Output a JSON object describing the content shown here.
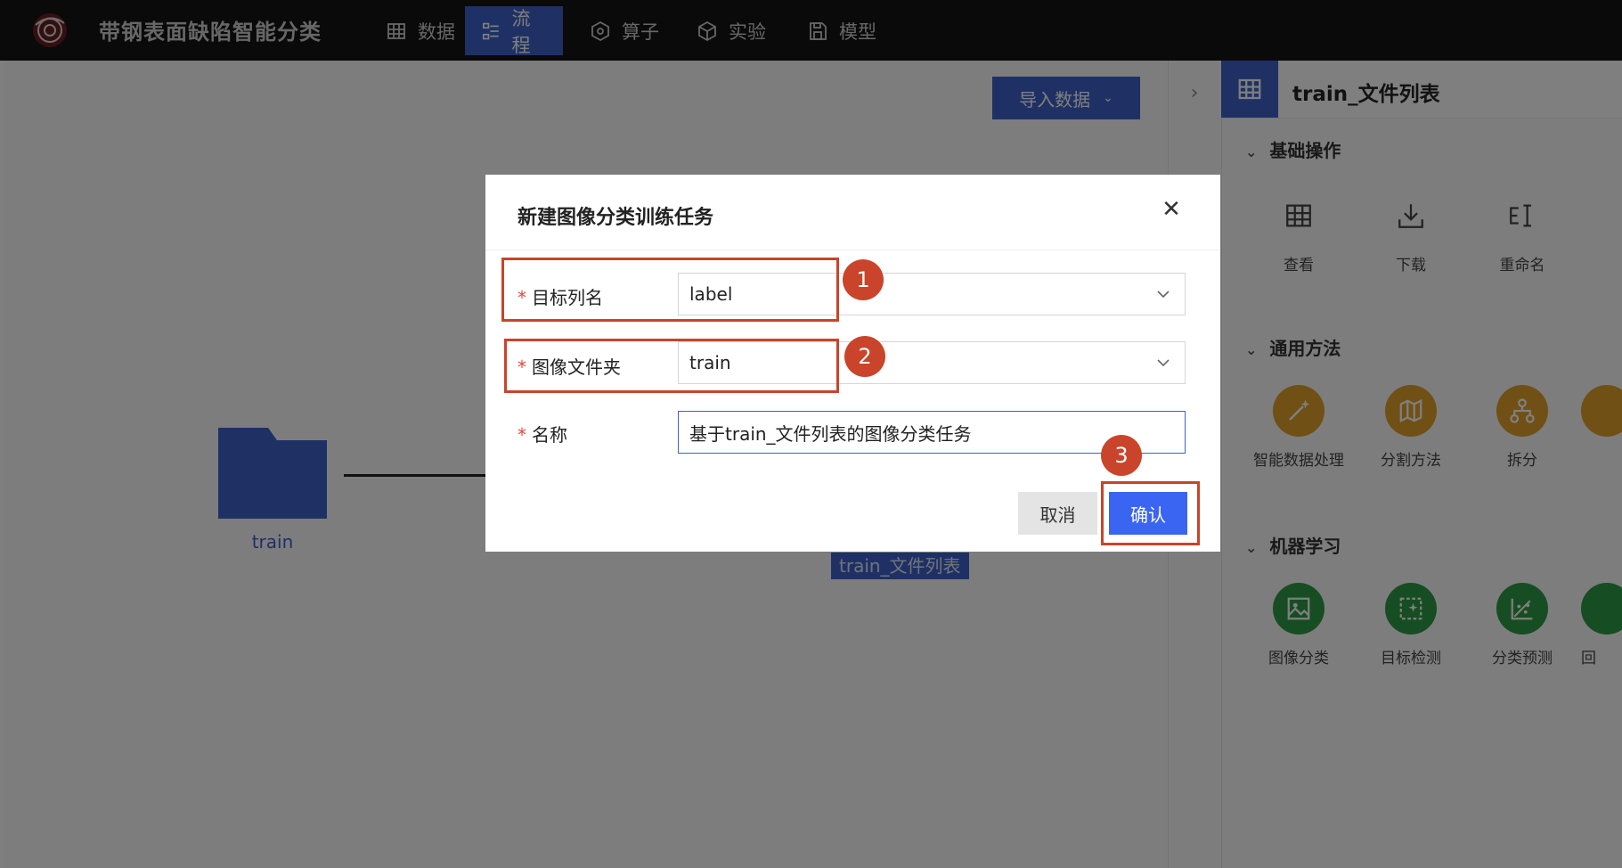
{
  "app": {
    "title": "带钢表面缺陷智能分类"
  },
  "nav": [
    {
      "label": "数据",
      "icon": "table-icon",
      "active": false
    },
    {
      "label": "流程",
      "icon": "flow-icon",
      "active": true
    },
    {
      "label": "算子",
      "icon": "hexagon-icon",
      "active": false
    },
    {
      "label": "实验",
      "icon": "cube-icon",
      "active": false
    },
    {
      "label": "模型",
      "icon": "save-icon",
      "active": false
    }
  ],
  "canvas": {
    "import_button": "导入数据",
    "node1_label": "train",
    "node2_label": "train_文件列表"
  },
  "right_panel": {
    "title": "train_文件列表",
    "sections": [
      {
        "title": "基础操作",
        "tools": [
          {
            "label": "查看",
            "icon": "grid-icon"
          },
          {
            "label": "下载",
            "icon": "download-icon"
          },
          {
            "label": "重命名",
            "icon": "rename-icon"
          }
        ]
      },
      {
        "title": "通用方法",
        "tools": [
          {
            "label": "智能数据处理",
            "icon": "magic-wand-icon"
          },
          {
            "label": "分割方法",
            "icon": "map-icon"
          },
          {
            "label": "拆分",
            "icon": "split-icon"
          }
        ]
      },
      {
        "title": "机器学习",
        "tools": [
          {
            "label": "图像分类",
            "icon": "image-icon"
          },
          {
            "label": "目标检测",
            "icon": "detect-icon"
          },
          {
            "label": "分类预测",
            "icon": "scatter-icon"
          },
          {
            "label": "回",
            "icon": "regression-icon"
          }
        ]
      }
    ]
  },
  "modal": {
    "title": "新建图像分类训练任务",
    "fields": [
      {
        "label": "目标列名",
        "value": "label",
        "type": "select"
      },
      {
        "label": "图像文件夹",
        "value": "train",
        "type": "select"
      },
      {
        "label": "名称",
        "value": "基于train_文件列表的图像分类任务",
        "type": "text"
      }
    ],
    "cancel_label": "取消",
    "confirm_label": "确认"
  },
  "annotations": [
    "1",
    "2",
    "3"
  ],
  "colors": {
    "accent": "#3e62c9",
    "primary_button": "#3a64f2",
    "highlight": "#c9442a",
    "ops_orange": "#e1a12b",
    "ml_green": "#2e9b45"
  }
}
